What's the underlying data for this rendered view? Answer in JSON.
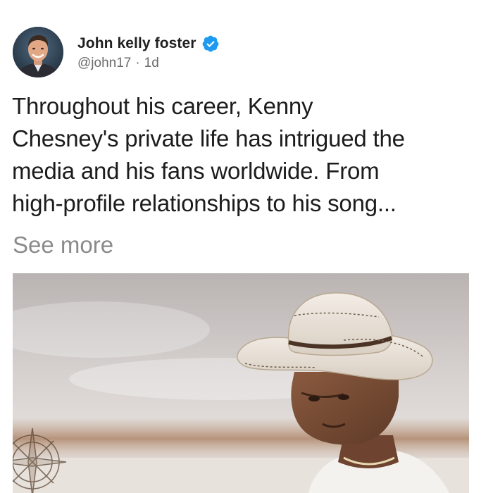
{
  "post": {
    "author_name": "John kelly foster",
    "handle": "@john17",
    "separator": "·",
    "time": "1d",
    "text": "Throughout his career, Kenny\nChesney's private life has intrigued the\nmedia and his fans worldwide. From\nhigh-profile relationships to his song...",
    "see_more_label": "See more"
  },
  "icons": {
    "verified": "verified-badge-icon",
    "avatar": "profile-photo",
    "media": "cowboy-hat-photo"
  },
  "colors": {
    "verified_blue": "#1d9bf0",
    "text": "#1c1c1c",
    "secondary_text": "#6b6b6b",
    "see_more": "#8a8a8a"
  }
}
